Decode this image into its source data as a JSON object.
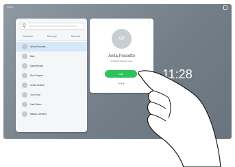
{
  "topbar": {
    "left_label": "Webex"
  },
  "search": {
    "placeholder_icon": "Q"
  },
  "tabs": [
    {
      "label": "Favorites",
      "active": true
    },
    {
      "label": "Directory",
      "active": false
    },
    {
      "label": "Recents",
      "active": false
    }
  ],
  "contacts": [
    {
      "name": "Anita Poscotto",
      "selected": true
    },
    {
      "name": "Bart",
      "selected": false
    },
    {
      "name": "Dave Brown",
      "selected": false
    },
    {
      "name": "Ron Puppet",
      "selected": false
    },
    {
      "name": "Irmak Gulhan",
      "selected": false
    },
    {
      "name": "John Doe",
      "selected": false
    },
    {
      "name": "Lisa Steen",
      "selected": false
    },
    {
      "name": "Nancy Clement",
      "selected": false
    }
  ],
  "detail": {
    "avatar_initials": "AP",
    "name": "Anita Poscotto",
    "subtitle": "anita@example.com",
    "call_label": "Call",
    "more_label": "•••"
  },
  "clock": {
    "time": "11:28"
  },
  "colors": {
    "call_green": "#2fc15b",
    "selected_row": "#d6e8f7",
    "accent_blue": "#2a82c9"
  }
}
